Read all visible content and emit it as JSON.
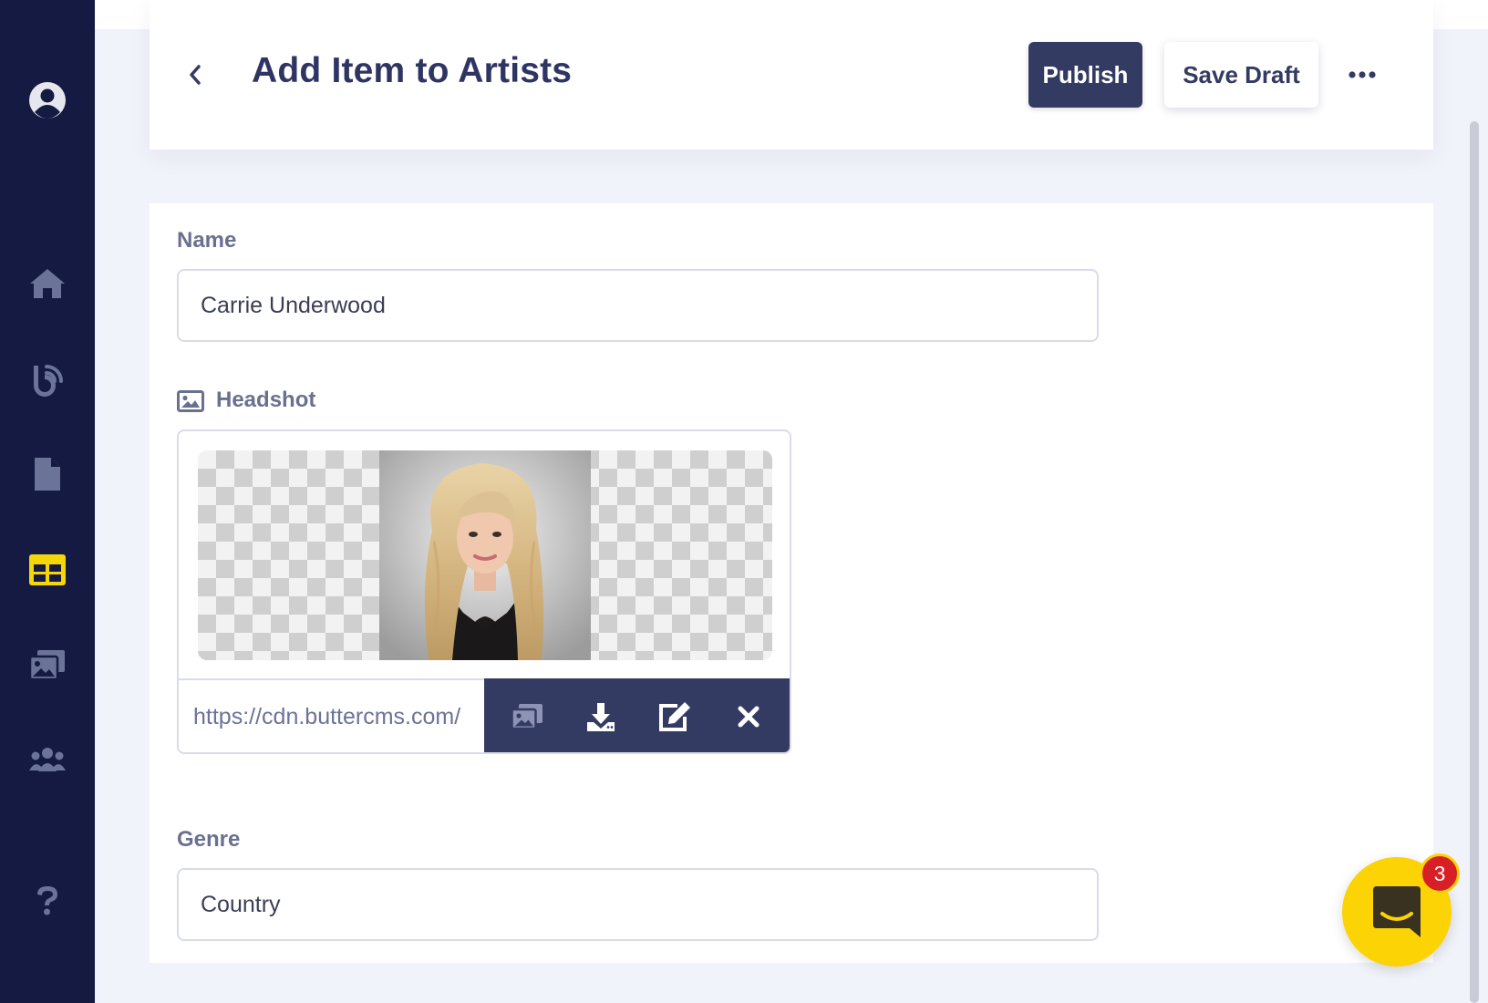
{
  "header": {
    "title": "Add Item to Artists",
    "publish_label": "Publish",
    "save_draft_label": "Save Draft"
  },
  "sidebar": {
    "items": [
      {
        "icon": "user-avatar-icon"
      },
      {
        "icon": "home-icon"
      },
      {
        "icon": "blog-icon"
      },
      {
        "icon": "pages-icon"
      },
      {
        "icon": "collections-icon",
        "active": true
      },
      {
        "icon": "media-library-icon"
      },
      {
        "icon": "users-icon"
      },
      {
        "icon": "help-icon"
      }
    ],
    "active_color": "#f5d60a"
  },
  "form": {
    "name": {
      "label": "Name",
      "value": "Carrie Underwood"
    },
    "headshot": {
      "label": "Headshot",
      "url_value": "https://cdn.buttercms.com/"
    },
    "genre": {
      "label": "Genre",
      "value": "Country"
    }
  },
  "chat": {
    "badge_count": "3"
  },
  "colors": {
    "sidebar_bg": "#141a42",
    "primary": "#343b63",
    "accent_yellow": "#fcd304",
    "badge_red": "#d81f26"
  }
}
